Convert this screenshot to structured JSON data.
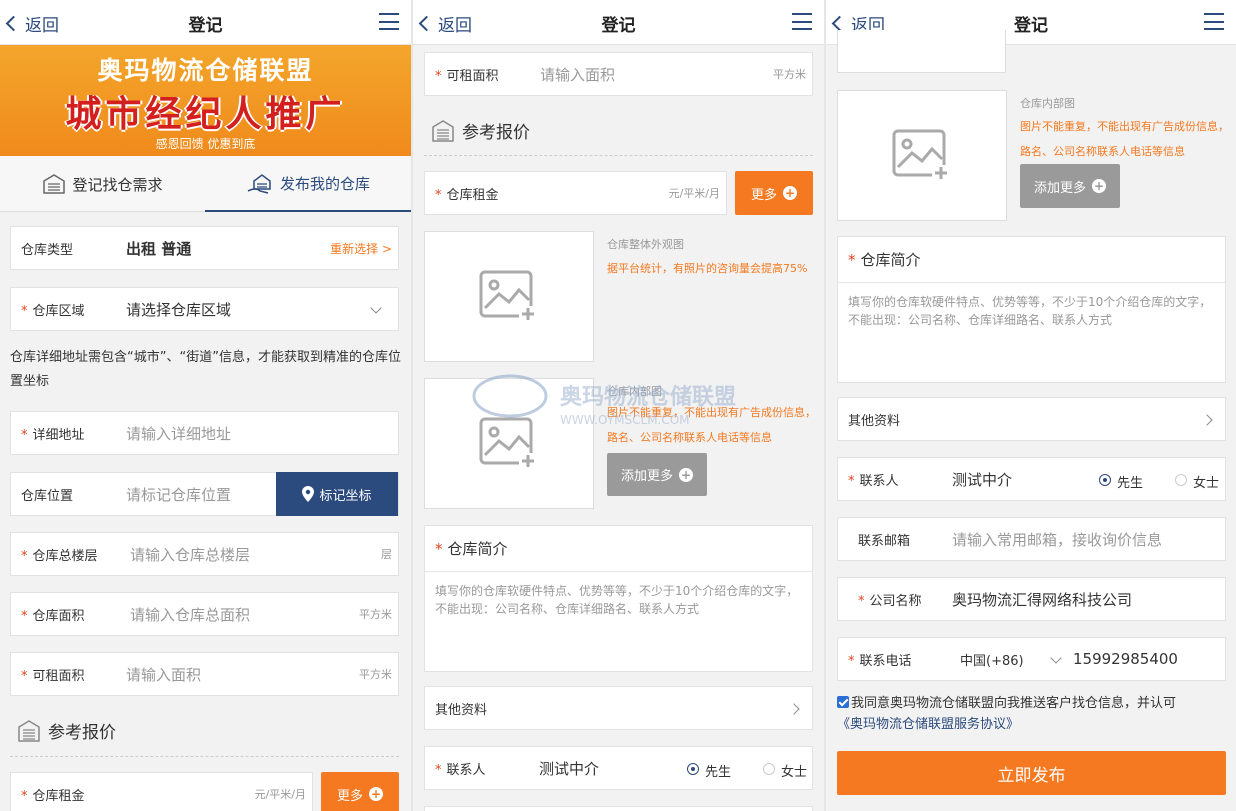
{
  "header": {
    "back_label": "返回",
    "title": "登记"
  },
  "banner": {
    "line1": "奥玛物流仓储联盟",
    "line2": "城市经纪人推广",
    "line3": "感恩回馈 优惠到底"
  },
  "tabs": [
    {
      "label": "登记找仓需求"
    },
    {
      "label": "发布我的仓库"
    }
  ],
  "form": {
    "type_label": "仓库类型",
    "type_value": "出租  普通",
    "reselect": "重新选择 >",
    "region_label": "仓库区域",
    "region_placeholder": "请选择仓库区域",
    "address_note": "仓库详细地址需包含“城市”、“街道”信息，才能获取到精准的仓库位置坐标",
    "address_label": "详细地址",
    "address_placeholder": "请输入详细地址",
    "location_label": "仓库位置",
    "location_placeholder": "请标记仓库位置",
    "mark_button": "标记坐标",
    "floors_label": "仓库总楼层",
    "floors_placeholder": "请输入仓库总楼层",
    "floors_unit": "层",
    "area_label": "仓库面积",
    "area_placeholder": "请输入仓库总面积",
    "area_unit": "平方米",
    "rent_area_label": "可租面积",
    "rent_area_placeholder": "请输入面积",
    "rent_area_unit": "平方米"
  },
  "pricing": {
    "section_title": "参考报价",
    "rent_label": "仓库租金",
    "rent_unit": "元/平米/月",
    "more_button": "更多"
  },
  "images": {
    "exterior_caption": "仓库整体外观图",
    "exterior_note": "据平台统计，有照片的咨询量会提高75%",
    "interior_caption": "仓库内部图",
    "interior_note": "图片不能重复，不能出现有广告成份信息，路名、公司名称联系人电话等信息",
    "add_more": "添加更多"
  },
  "intro": {
    "title": "仓库简介",
    "placeholder": "填写你的仓库软硬件特点、优势等等，不少于10个介绍仓库的文字，不能出现：公司名称、仓库详细路名、联系人方式"
  },
  "other": {
    "label": "其他资料"
  },
  "contact": {
    "person_label": "联系人",
    "person_value": "测试中介",
    "mr": "先生",
    "ms": "女士",
    "email_label": "联系邮箱",
    "email_placeholder": "请输入常用邮箱，接收询价信息",
    "company_label": "公司名称",
    "company_value": "奥玛物流汇得网络科技公司",
    "phone_label": "联系电话",
    "country": "中国(+86)",
    "phone_value": "15992985400"
  },
  "agreement": {
    "text": "我同意奥玛物流仓储联盟向我推送客户找仓信息，并认可",
    "link": "《奥玛物流仓储联盟服务协议》"
  },
  "publish": {
    "label": "立即发布"
  },
  "watermark": {
    "line1": "奥玛物流仓储联盟",
    "line2": "WWW.OYMSCLM.COM"
  },
  "colors": {
    "primary": "#2b4a7d",
    "accent": "#f47920",
    "required": "#e0431d"
  }
}
